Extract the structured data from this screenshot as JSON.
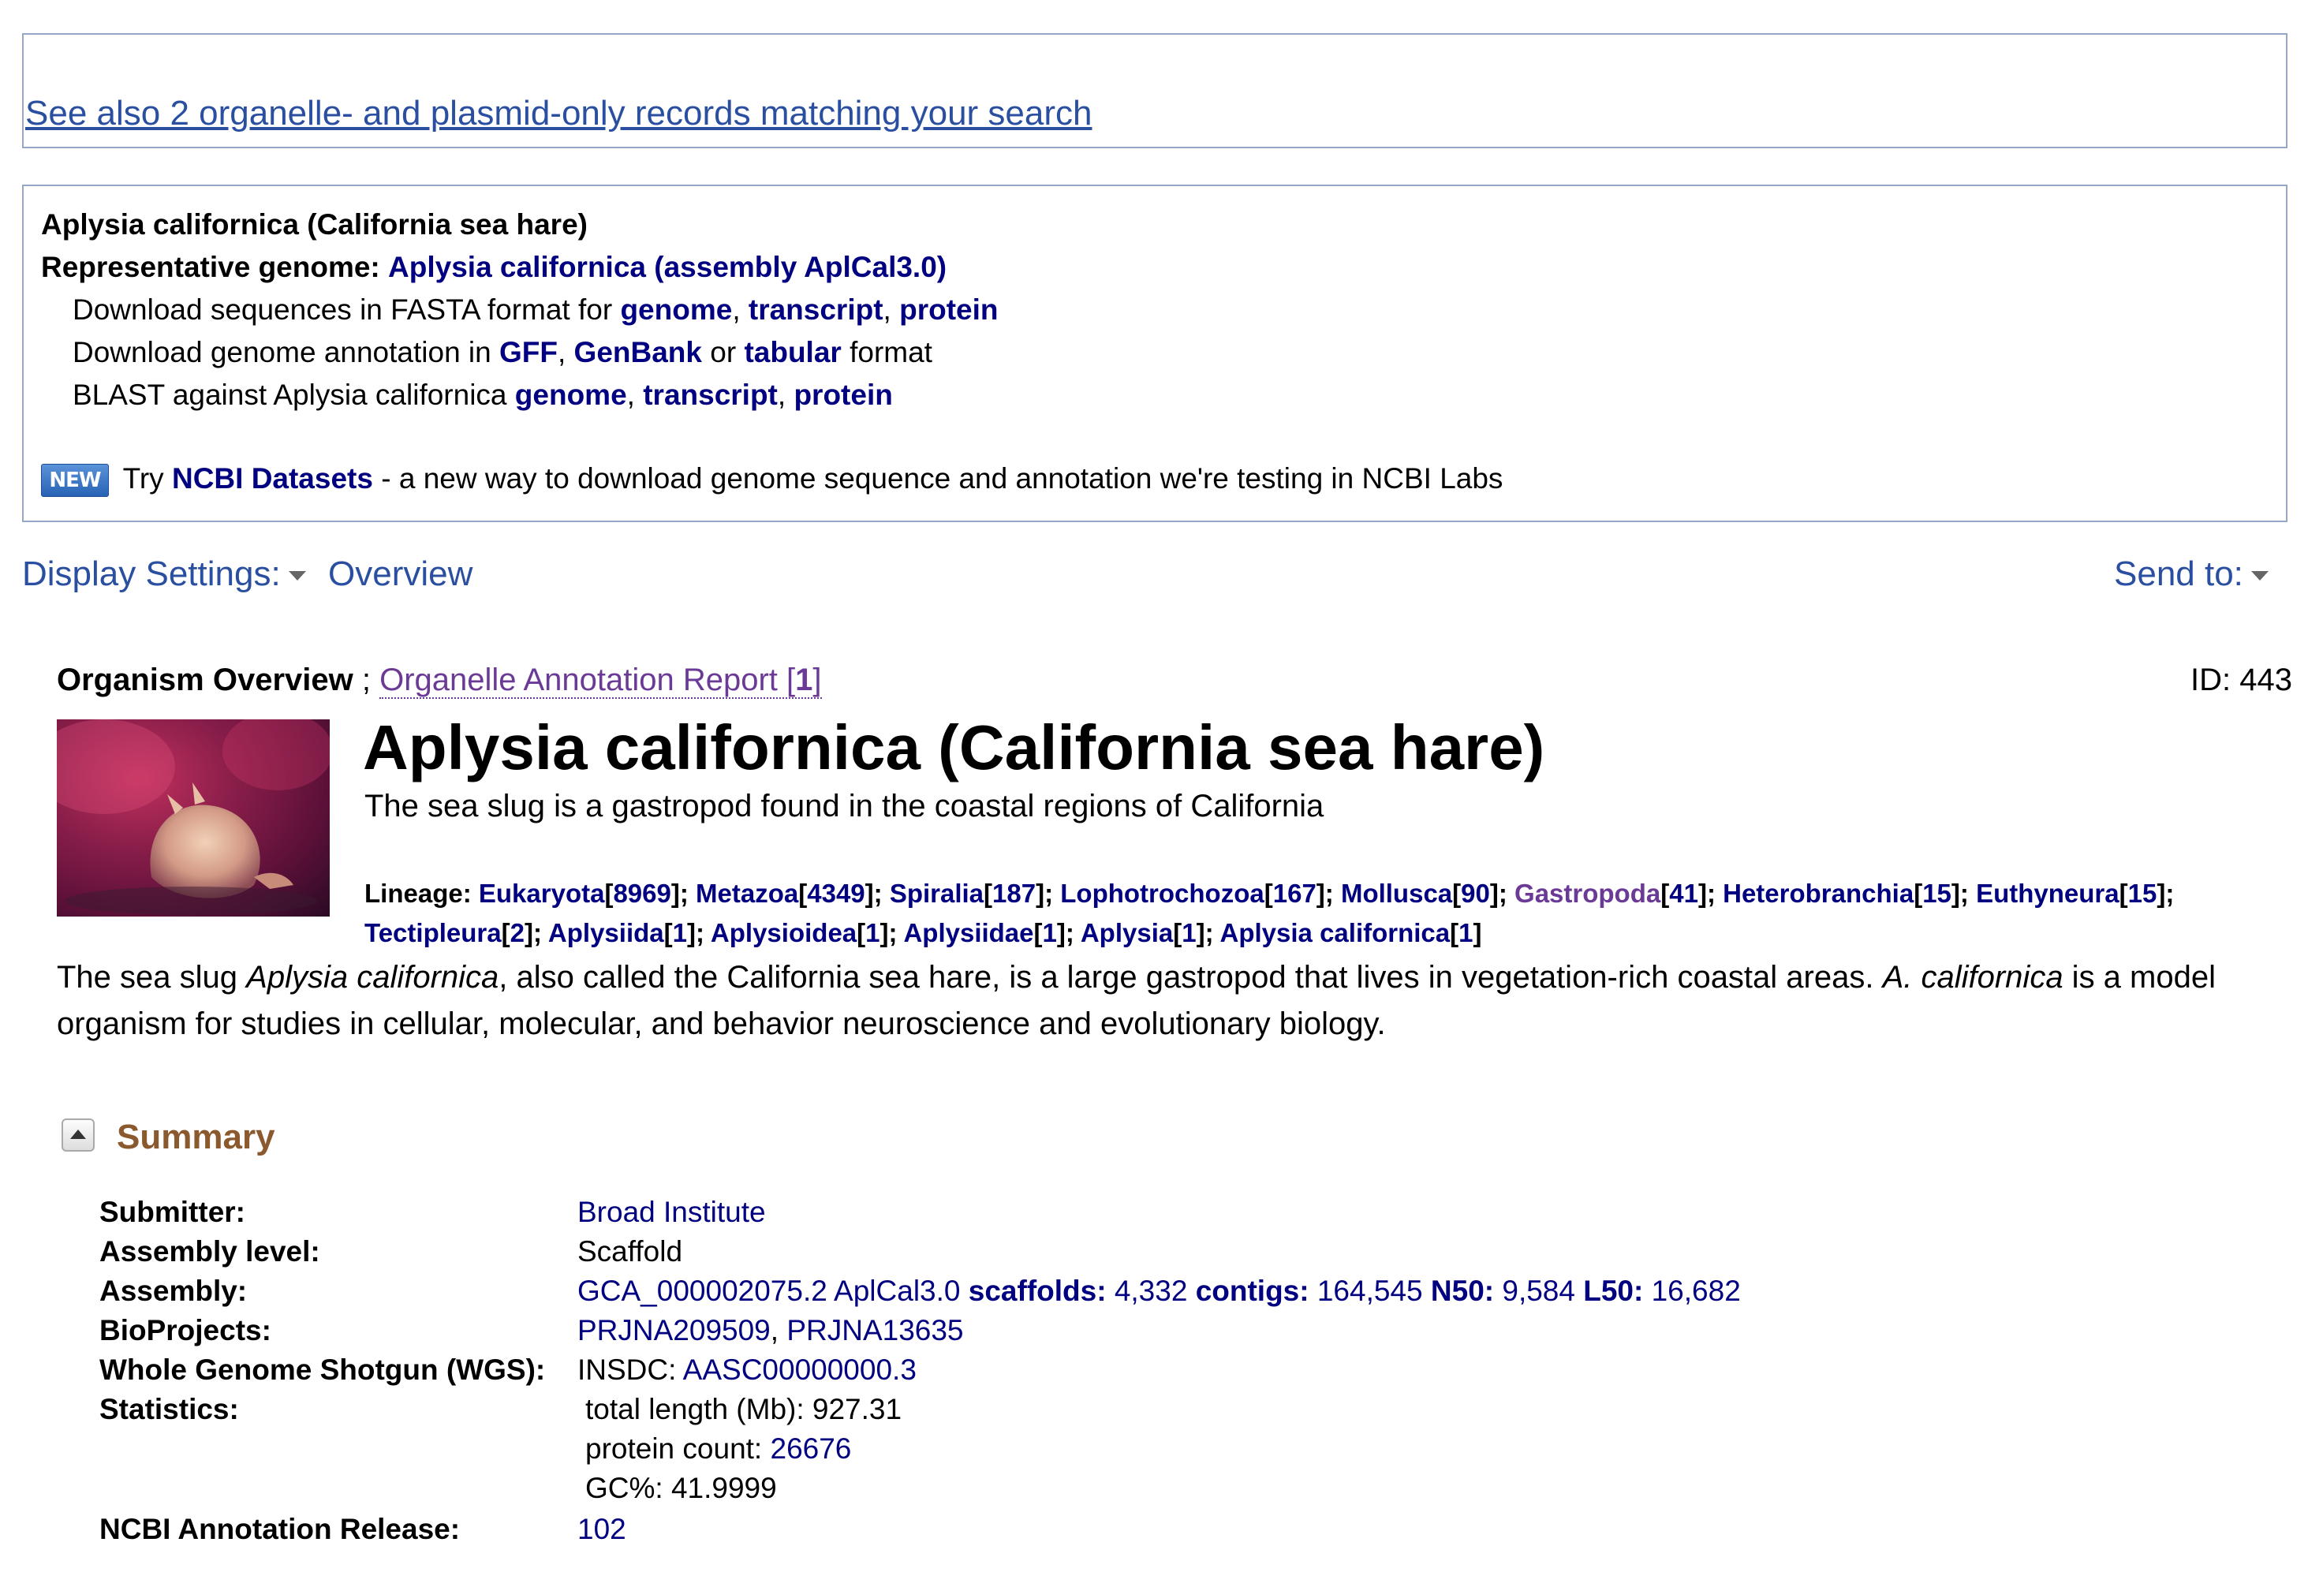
{
  "see_also": "See also 2 organelle- and plasmid-only records matching your search",
  "genome_box": {
    "organism": "Aplysia californica (California sea hare)",
    "rep_label": "Representative genome:",
    "rep_link": "Aplysia californica (assembly AplCal3.0)",
    "fasta_prefix": "Download sequences in FASTA format for",
    "fasta_links": [
      "genome",
      "transcript",
      "protein"
    ],
    "annot_prefix": "Download genome annotation in",
    "annot_links": [
      "GFF",
      "GenBank",
      "tabular"
    ],
    "annot_or": "or",
    "annot_suffix": "format",
    "blast_prefix": "BLAST against Aplysia californica",
    "blast_links": [
      "genome",
      "transcript",
      "protein"
    ],
    "new_badge": "NEW",
    "try": "Try",
    "datasets_link": "NCBI Datasets",
    "datasets_rest": "- a new way to download genome sequence and annotation we're testing in NCBI Labs"
  },
  "toolbar": {
    "display_settings": "Display Settings:",
    "overview": "Overview",
    "send_to": "Send to:"
  },
  "report": {
    "tab_active": "Organism Overview",
    "sep": ";",
    "tab_link": "Organelle Annotation Report",
    "tab_count": "1",
    "id": "ID: 443",
    "title": "Aplysia californica (California sea hare)",
    "subtitle": "The sea slug is a gastropod found in the coastal regions of California",
    "lineage_label": "Lineage:",
    "lineage": [
      {
        "name": "Eukaryota",
        "count": "8969"
      },
      {
        "name": "Metazoa",
        "count": "4349"
      },
      {
        "name": "Spiralia",
        "count": "187"
      },
      {
        "name": "Lophotrochozoa",
        "count": "167"
      },
      {
        "name": "Mollusca",
        "count": "90"
      },
      {
        "name": "Gastropoda",
        "count": "41"
      },
      {
        "name": "Heterobranchia",
        "count": "15"
      },
      {
        "name": "Euthyneura",
        "count": "15"
      },
      {
        "name": "Tectipleura",
        "count": "2"
      },
      {
        "name": "Aplysiida",
        "count": "1"
      },
      {
        "name": "Aplysioidea",
        "count": "1"
      },
      {
        "name": "Aplysiidae",
        "count": "1"
      },
      {
        "name": "Aplysia",
        "count": "1"
      },
      {
        "name": "Aplysia californica",
        "count": "1"
      }
    ],
    "desc": {
      "p1": "The sea slug ",
      "i1": "Aplysia californica",
      "p2": ", also called the California sea hare, is a large gastropod that lives in vegetation-rich coastal areas. ",
      "i2": "A. californica",
      "p3": " is a model organism for studies in cellular, molecular, and behavior neuroscience and evolutionary biology."
    }
  },
  "summary": {
    "title": "Summary",
    "submitter_k": "Submitter:",
    "submitter_v": "Broad Institute",
    "level_k": "Assembly level:",
    "level_v": "Scaffold",
    "assembly_k": "Assembly:",
    "assembly_acc": "GCA_000002075.2 AplCal3.0",
    "scaffolds_k": "scaffolds:",
    "scaffolds_v": "4,332",
    "contigs_k": "contigs:",
    "contigs_v": "164,545",
    "n50_k": "N50:",
    "n50_v": "9,584",
    "l50_k": "L50:",
    "l50_v": "16,682",
    "bioprojects_k": "BioProjects:",
    "bioprojects_v1": "PRJNA209509",
    "bioprojects_v2": "PRJNA13635",
    "wgs_k": "Whole Genome Shotgun (WGS):",
    "wgs_prefix": "INSDC:",
    "wgs_v": "AASC00000000.3",
    "stats_k": "Statistics:",
    "total_length": "total length (Mb): 927.31",
    "protein_count_label": "protein count:",
    "protein_count": "26676",
    "gc": "GC%: 41.9999",
    "release_k": "NCBI Annotation Release:",
    "release_v": "102"
  }
}
